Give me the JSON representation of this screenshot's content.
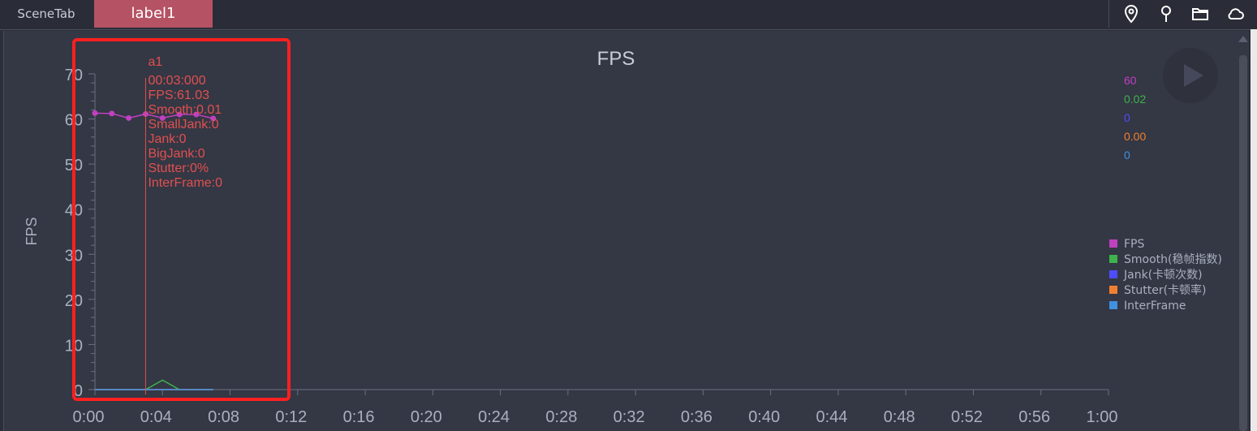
{
  "tabs": {
    "scene": "SceneTab",
    "active": "label1"
  },
  "icons": [
    "location-pin-icon",
    "pin-icon",
    "folder-icon",
    "cloud-icon"
  ],
  "chart_data": {
    "type": "line",
    "title": "FPS",
    "ylabel": "FPS",
    "xlabel": "",
    "ylim": [
      0,
      70
    ],
    "yticks": [
      0,
      10,
      20,
      30,
      40,
      50,
      60,
      70
    ],
    "xlim": [
      0,
      60
    ],
    "xticks": [
      "0:00",
      "0:04",
      "0:08",
      "0:12",
      "0:16",
      "0:20",
      "0:24",
      "0:28",
      "0:32",
      "0:36",
      "0:40",
      "0:44",
      "0:48",
      "0:52",
      "0:56",
      "1:00"
    ],
    "series": [
      {
        "name": "FPS",
        "legend": "FPS",
        "color": "#c040c0",
        "x": [
          0,
          1,
          2,
          3,
          4,
          5,
          6,
          7
        ],
        "y": [
          61.3,
          61.2,
          60.2,
          61.1,
          60.2,
          61.0,
          61.0,
          60.1
        ],
        "markers": true
      },
      {
        "name": "Smooth",
        "legend": "Smooth(稳帧指数)",
        "color": "#3cb44b",
        "x": [
          0,
          1,
          2,
          3,
          4,
          5,
          6,
          7
        ],
        "y": [
          0,
          0,
          0,
          0,
          2.1,
          0,
          0,
          0
        ]
      },
      {
        "name": "Jank",
        "legend": "Jank(卡顿次数)",
        "color": "#4d4dff",
        "x": [
          0,
          1,
          2,
          3,
          4,
          5,
          6,
          7
        ],
        "y": [
          0,
          0,
          0,
          0,
          0,
          0,
          0,
          0
        ]
      },
      {
        "name": "Stutter",
        "legend": "Stutter(卡顿率)",
        "color": "#f08030",
        "x": [
          0,
          1,
          2,
          3,
          4,
          5,
          6,
          7
        ],
        "y": [
          0,
          0,
          0,
          0,
          0,
          0,
          0,
          0
        ]
      },
      {
        "name": "InterFrame",
        "legend": "InterFrame",
        "color": "#4090e0",
        "x": [
          0,
          1,
          2,
          3,
          4,
          5,
          6,
          7
        ],
        "y": [
          0,
          0,
          0,
          0,
          0,
          0,
          0,
          0
        ]
      }
    ],
    "current_values": [
      {
        "text": "60",
        "color": "#c040c0"
      },
      {
        "text": "0.02",
        "color": "#3cb44b"
      },
      {
        "text": "0",
        "color": "#4d4dff"
      },
      {
        "text": "0.00",
        "color": "#f08030"
      },
      {
        "text": "0",
        "color": "#4090e0"
      }
    ],
    "marker": {
      "x": 3,
      "label": "a1",
      "color": "#e05050",
      "lines": [
        "00:03:000",
        "FPS:61.03",
        "Smooth:0.01",
        "SmallJank:0",
        "Jank:0",
        "BigJank:0",
        "Stutter:0%",
        "InterFrame:0"
      ]
    },
    "highlight_color": "#ff2020"
  }
}
